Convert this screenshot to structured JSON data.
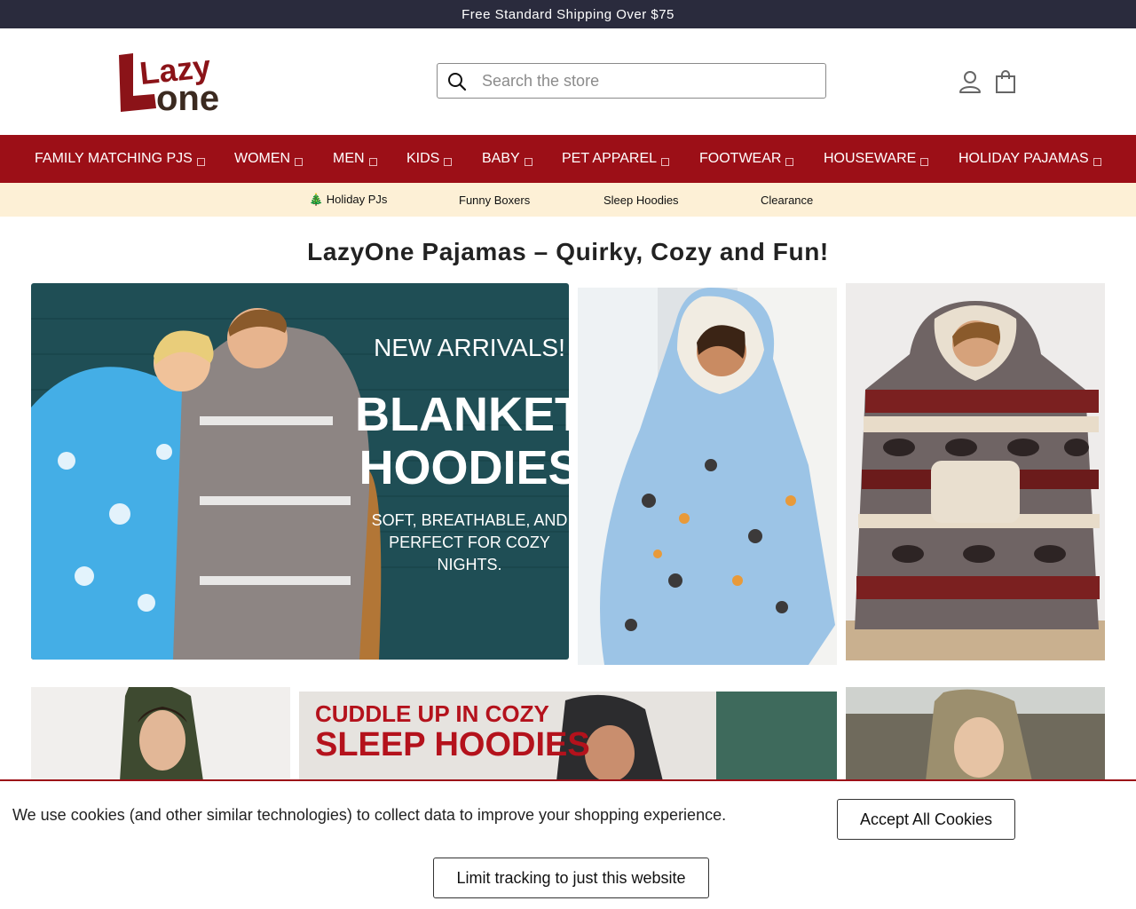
{
  "announcement": "Free Standard Shipping Over $75",
  "logo": {
    "text_top": "Lazy",
    "text_bottom": "one"
  },
  "search": {
    "placeholder": "Search the store"
  },
  "nav": {
    "items": [
      {
        "label": "FAMILY MATCHING PJS"
      },
      {
        "label": "WOMEN"
      },
      {
        "label": "MEN"
      },
      {
        "label": "KIDS"
      },
      {
        "label": "BABY"
      },
      {
        "label": "PET APPAREL"
      },
      {
        "label": "FOOTWEAR"
      },
      {
        "label": "HOUSEWARE"
      },
      {
        "label": "HOLIDAY PAJAMAS"
      }
    ]
  },
  "subnav": {
    "items": [
      {
        "label": "🎄 Holiday PJs"
      },
      {
        "label": "Funny Boxers"
      },
      {
        "label": "Sleep Hoodies"
      },
      {
        "label": "Clearance"
      }
    ]
  },
  "headline": "LazyOne Pajamas – Quirky, Cozy and Fun!",
  "hero": {
    "line1": "NEW ARRIVALS!",
    "line2": "BLANKET",
    "line3": "HOODIES",
    "line4": "SOFT, BREATHABLE, AND",
    "line5": "PERFECT FOR COZY",
    "line6": "NIGHTS."
  },
  "banner2": {
    "line1": "CUDDLE UP IN COZY",
    "line2": "SLEEP HOODIES"
  },
  "cookie": {
    "message": "We use cookies (and other similar technologies) to collect data to improve your shopping experience.",
    "accept_label": "Accept All Cookies",
    "limit_label": "Limit tracking to just this website"
  },
  "colors": {
    "brand_red": "#9c0f17",
    "topbar": "#2a2b3d",
    "subnav_bg": "#fdf0d6"
  }
}
